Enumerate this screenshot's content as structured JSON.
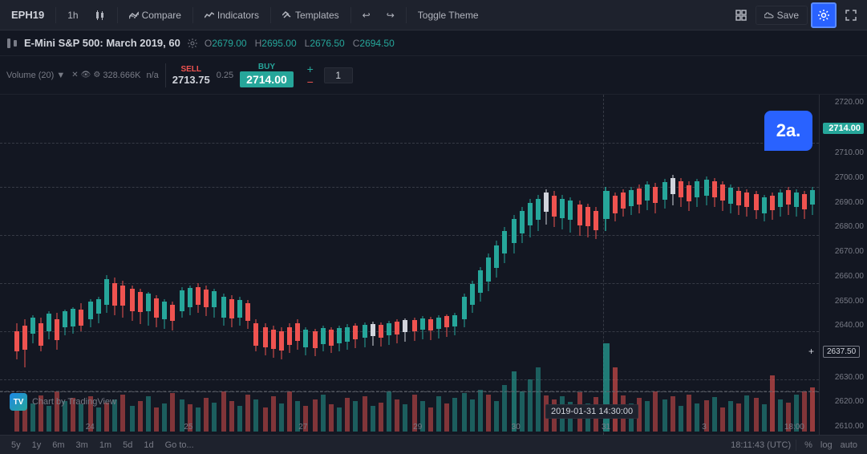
{
  "toolbar": {
    "symbol": "EPH19",
    "timeframe": "1h",
    "compare_label": "Compare",
    "indicators_label": "Indicators",
    "templates_label": "Templates",
    "toggle_theme_label": "Toggle Theme",
    "save_label": "Save",
    "undo_icon": "↩",
    "redo_icon": "↪"
  },
  "chart_header": {
    "title": "E-Mini S&P 500: March 2019, 60",
    "open_label": "O",
    "open_val": "2679.00",
    "high_label": "H",
    "high_val": "2695.00",
    "low_label": "L",
    "low_val": "2676.50",
    "close_label": "C",
    "close_val": "2694.50"
  },
  "trade_panel": {
    "volume_label": "Volume (20)",
    "volume_val": "328.666K",
    "volume_na": "n/a",
    "sell_label": "SELL",
    "sell_price": "2713.75",
    "spread": "0.25",
    "buy_label": "BUY",
    "buy_price": "2714.00",
    "qty": "1"
  },
  "price_scale": {
    "prices": [
      "2720.00",
      "2714.00",
      "2710.00",
      "2700.00",
      "2690.00",
      "2680.00",
      "2670.00",
      "2660.00",
      "2650.00",
      "2640.00",
      "2637.50",
      "2630.00",
      "2620.00",
      "2610.00"
    ]
  },
  "callout": {
    "label": "2a."
  },
  "date_labels": [
    "24",
    "25",
    "27",
    "29",
    "30",
    "31",
    "3"
  ],
  "bottom_bar": {
    "timeframes": [
      "5y",
      "1y",
      "6m",
      "3m",
      "1m",
      "5d",
      "1d",
      "Go to..."
    ],
    "current_time": "18:11:43 (UTC)",
    "pct_label": "%",
    "log_label": "log",
    "auto_label": "auto",
    "date_hover": "2019-01-31  14:30:00",
    "time_18": "18:00"
  },
  "tv_logo": {
    "text": "Chart by TradingView"
  }
}
